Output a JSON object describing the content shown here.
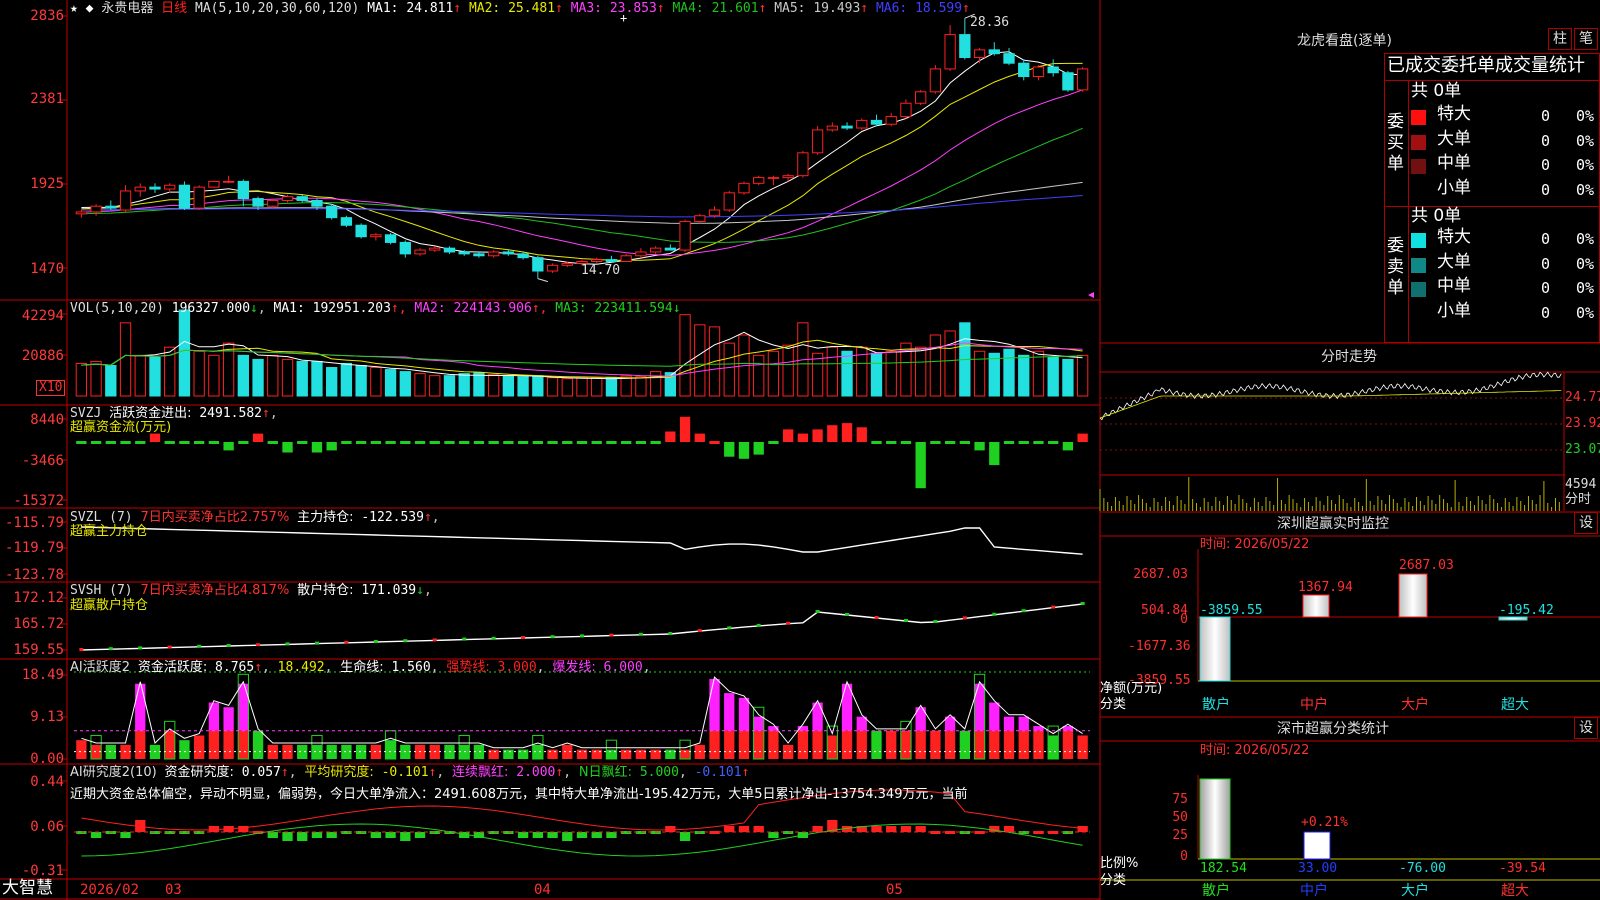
{
  "stock": {
    "name": "永贵电器",
    "period": "日线",
    "ma_label": "MA(5,10,20,30,60,120)",
    "ma": [
      {
        "k": "MA1",
        "v": "24.811",
        "c": "#ffffff"
      },
      {
        "k": "MA2",
        "v": "25.481",
        "c": "#e8e800"
      },
      {
        "k": "MA3",
        "v": "23.853",
        "c": "#ff40ff"
      },
      {
        "k": "MA4",
        "v": "21.601",
        "c": "#20c020"
      },
      {
        "k": "MA5",
        "v": "19.493",
        "c": "#c8c8c8"
      },
      {
        "k": "MA6",
        "v": "18.599",
        "c": "#4040ff"
      }
    ],
    "high_label": "28.36",
    "low_label": "14.70"
  },
  "axes": {
    "price": [
      "2836",
      "2381",
      "1925",
      "1470"
    ],
    "vol": [
      "42294",
      "20886"
    ],
    "vol_unit": "X10",
    "svzj": [
      "8440",
      "-3466",
      "-15372"
    ],
    "svzl": [
      "-115.79",
      "-119.79",
      "-123.78"
    ],
    "svsh": [
      "172.12",
      "165.72",
      "159.55"
    ],
    "ai1": [
      "18.49",
      "9.13",
      "0.00"
    ],
    "ai2": [
      "0.44",
      "0.06",
      "-0.31"
    ],
    "dates": [
      "2026/02",
      "03",
      "04",
      "05"
    ]
  },
  "panels": {
    "vol": {
      "label": "VOL(5,10,20)",
      "value": "196327.000",
      "ma": [
        {
          "k": "MA1",
          "v": "192951.203",
          "c": "#ffffff"
        },
        {
          "k": "MA2",
          "v": "224143.906",
          "c": "#ff40ff"
        },
        {
          "k": "MA3",
          "v": "223411.594",
          "c": "#20d020"
        }
      ]
    },
    "svzj": {
      "label": "SVZJ",
      "desc": "活跃资金进出:",
      "value": "2491.582",
      "sub": "超赢资金流(万元)"
    },
    "svzl": {
      "label": "SVZL (7)",
      "desc": "7日内买卖净占比2.757%",
      "desc2": "主力持仓:",
      "value": "-122.539",
      "sub": "超赢主力持仓"
    },
    "svsh": {
      "label": "SVSH (7)",
      "desc": "7日内买卖净占比4.817%",
      "desc2": "散户持仓:",
      "value": "171.039",
      "sub": "超赢散户持仓"
    },
    "ai1": {
      "label": "AI活跃度2",
      "desc": "资金活跃度:",
      "value": "8.765",
      "v2": "18.492",
      "desc3": "生命线:",
      "v3": "1.560",
      "desc4": "强势线:",
      "v4": "3.000",
      "desc5": "爆发线:",
      "v5": "6.000"
    },
    "ai2": {
      "label": "AI研究度2(10)",
      "desc": "资金研究度:",
      "value": "0.057",
      "desc2": "平均研究度:",
      "v2": "-0.101",
      "desc3": "连续飘红:",
      "v3": "2.000",
      "desc4": "N日飘红:",
      "v4": "5.000",
      "v5": "-0.101",
      "comment": "近期大资金总体偏空，异动不明显，偏弱势，今日大单净流入：2491.608万元，其中特大单净流出-195.42万元，大单5日累计净出-13754.349万元，当前"
    }
  },
  "bottom": {
    "brand": "大智慧"
  },
  "right": {
    "lhb_title": "龙虎看盘(逐单)",
    "tab1": "柱",
    "tab2": "笔",
    "stats_title": "已成交委托单成交量统计",
    "buy": {
      "label": "委买单",
      "total": "共 0单",
      "rows": [
        {
          "n": "特大",
          "a": "0",
          "p": "0%",
          "c": "#ff1010"
        },
        {
          "n": "大单",
          "a": "0",
          "p": "0%",
          "c": "#a01010"
        },
        {
          "n": "中单",
          "a": "0",
          "p": "0%",
          "c": "#701010"
        },
        {
          "n": "小单",
          "a": "0",
          "p": "0%",
          "c": "#000000"
        }
      ]
    },
    "sell": {
      "label": "委卖单",
      "total": "共 0单",
      "rows": [
        {
          "n": "特大",
          "a": "0",
          "p": "0%",
          "c": "#10e0e0"
        },
        {
          "n": "大单",
          "a": "0",
          "p": "0%",
          "c": "#108888"
        },
        {
          "n": "中单",
          "a": "0",
          "p": "0%",
          "c": "#107070"
        },
        {
          "n": "小单",
          "a": "0",
          "p": "0%",
          "c": "#000000"
        }
      ]
    },
    "fs_title": "分时走势",
    "fs_axis": [
      "24.77",
      "23.92",
      "23.07"
    ],
    "fs_vol": "4594",
    "fs_vol_unit": "分时",
    "sz_title": "深圳超赢实时监控",
    "sz_set": "设",
    "sz_time": "时间: 2026/05/22",
    "sz_axis": [
      "2687.03",
      "504.84",
      "0",
      "-1677.36",
      "-3859.55"
    ],
    "sz_ylabel": "净额(万元)",
    "sz_xlabel": "分类",
    "sz_values": [
      {
        "cat": "散户",
        "v": "-3859.55"
      },
      {
        "cat": "中户",
        "v": "1367.94"
      },
      {
        "cat": "大户",
        "v": "2687.03"
      },
      {
        "cat": "超大",
        "v": "-195.42"
      }
    ],
    "sc_title": "深市超赢分类统计",
    "sc_set": "设",
    "sc_time": "时间: 2026/05/22",
    "sc_axis": [
      "75",
      "50",
      "25",
      "0"
    ],
    "sc_ylabel": "比例%",
    "sc_xlabel": "分类",
    "sc_values": [
      {
        "cat": "散户",
        "v": "182.54"
      },
      {
        "cat": "中户",
        "v": "33.00"
      },
      {
        "cat": "大户",
        "v": "-76.00"
      },
      {
        "cat": "超大",
        "v": "-39.54"
      }
    ],
    "sc_pct": "+0.21%"
  },
  "chart_data": {
    "type": "candlestick",
    "price_ylim": [
      14.0,
      29.0
    ],
    "candles": [
      [
        18.1,
        18.3,
        17.9,
        18.2
      ],
      [
        18.2,
        18.6,
        18.0,
        18.5
      ],
      [
        18.5,
        18.8,
        18.3,
        18.4
      ],
      [
        18.3,
        19.6,
        18.2,
        19.3
      ],
      [
        19.3,
        19.7,
        19.0,
        19.5
      ],
      [
        19.5,
        19.7,
        19.2,
        19.4
      ],
      [
        19.4,
        19.7,
        19.2,
        19.6
      ],
      [
        19.6,
        19.8,
        18.3,
        18.4
      ],
      [
        18.4,
        19.6,
        18.3,
        19.5
      ],
      [
        19.5,
        19.8,
        19.5,
        19.8
      ],
      [
        19.8,
        20.1,
        19.7,
        19.8
      ],
      [
        19.8,
        19.9,
        18.5,
        18.9
      ],
      [
        18.9,
        19.0,
        18.3,
        18.5
      ],
      [
        18.5,
        18.9,
        18.4,
        18.8
      ],
      [
        18.8,
        19.1,
        18.7,
        19.0
      ],
      [
        19.0,
        19.1,
        18.7,
        18.8
      ],
      [
        18.8,
        18.9,
        18.3,
        18.5
      ],
      [
        18.5,
        18.6,
        17.8,
        17.9
      ],
      [
        17.9,
        18.0,
        17.4,
        17.5
      ],
      [
        17.5,
        17.6,
        16.8,
        16.9
      ],
      [
        16.9,
        17.1,
        16.7,
        17.0
      ],
      [
        17.0,
        17.1,
        16.5,
        16.6
      ],
      [
        16.6,
        16.7,
        15.8,
        16.0
      ],
      [
        16.0,
        16.3,
        15.9,
        16.2
      ],
      [
        16.2,
        16.4,
        16.1,
        16.3
      ],
      [
        16.3,
        16.4,
        16.0,
        16.1
      ],
      [
        16.1,
        16.2,
        15.9,
        16.0
      ],
      [
        16.0,
        16.1,
        15.8,
        15.9
      ],
      [
        15.9,
        16.2,
        15.8,
        16.1
      ],
      [
        16.1,
        16.2,
        15.9,
        16.0
      ],
      [
        16.0,
        16.1,
        15.7,
        15.8
      ],
      [
        15.8,
        15.9,
        14.7,
        15.1
      ],
      [
        15.1,
        15.5,
        15.0,
        15.4
      ],
      [
        15.4,
        15.6,
        15.3,
        15.5
      ],
      [
        15.5,
        15.7,
        15.4,
        15.6
      ],
      [
        15.6,
        15.8,
        15.5,
        15.7
      ],
      [
        15.7,
        15.9,
        15.6,
        15.6
      ],
      [
        15.6,
        16.0,
        15.6,
        15.9
      ],
      [
        15.9,
        16.3,
        15.8,
        16.1
      ],
      [
        16.1,
        16.4,
        16.0,
        16.3
      ],
      [
        16.3,
        16.5,
        16.2,
        16.2
      ],
      [
        16.2,
        17.8,
        16.1,
        17.7
      ],
      [
        17.7,
        18.1,
        17.6,
        18.0
      ],
      [
        18.0,
        18.5,
        17.9,
        18.3
      ],
      [
        18.3,
        19.3,
        18.2,
        19.2
      ],
      [
        19.2,
        19.8,
        19.1,
        19.7
      ],
      [
        19.7,
        20.1,
        19.6,
        20.0
      ],
      [
        20.0,
        20.1,
        19.6,
        20.0
      ],
      [
        20.0,
        20.2,
        19.8,
        20.1
      ],
      [
        20.1,
        21.4,
        20.0,
        21.3
      ],
      [
        21.3,
        22.7,
        21.2,
        22.5
      ],
      [
        22.5,
        22.9,
        22.4,
        22.7
      ],
      [
        22.7,
        22.9,
        22.5,
        22.6
      ],
      [
        22.6,
        23.1,
        22.5,
        23.0
      ],
      [
        23.0,
        23.3,
        22.7,
        22.8
      ],
      [
        22.8,
        23.4,
        22.7,
        23.2
      ],
      [
        23.2,
        24.1,
        23.1,
        23.9
      ],
      [
        23.9,
        24.6,
        23.8,
        24.5
      ],
      [
        24.5,
        25.9,
        24.4,
        25.7
      ],
      [
        25.7,
        28.0,
        25.6,
        27.5
      ],
      [
        27.5,
        28.36,
        26.2,
        26.3
      ],
      [
        26.3,
        26.8,
        26.0,
        26.7
      ],
      [
        26.7,
        27.1,
        26.4,
        26.5
      ],
      [
        26.5,
        26.8,
        25.9,
        26.0
      ],
      [
        26.0,
        26.2,
        25.1,
        25.3
      ],
      [
        25.3,
        25.9,
        25.1,
        25.8
      ],
      [
        25.8,
        26.2,
        25.3,
        25.5
      ],
      [
        25.5,
        25.6,
        24.5,
        24.6
      ],
      [
        24.6,
        25.8,
        24.5,
        25.7
      ]
    ],
    "vol_ylim": [
      0,
      42294
    ],
    "volumes": [
      16000,
      17000,
      15000,
      36000,
      20000,
      19000,
      24000,
      42294,
      22000,
      20000,
      26000,
      20000,
      18000,
      20000,
      18000,
      17000,
      17000,
      14000,
      16000,
      15000,
      14000,
      13000,
      12000,
      11000,
      10000,
      10000,
      11000,
      11500,
      10500,
      10000,
      9500,
      10000,
      9000,
      8500,
      9000,
      9000,
      9200,
      9800,
      9500,
      12000,
      11500,
      40000,
      35000,
      34000,
      26000,
      30000,
      20000,
      22000,
      25000,
      36000,
      21000,
      24000,
      22000,
      24000,
      21000,
      22000,
      26000,
      24000,
      30000,
      32000,
      36000,
      22000,
      21000,
      23000,
      20000,
      22000,
      19000,
      18000,
      20000
    ]
  }
}
